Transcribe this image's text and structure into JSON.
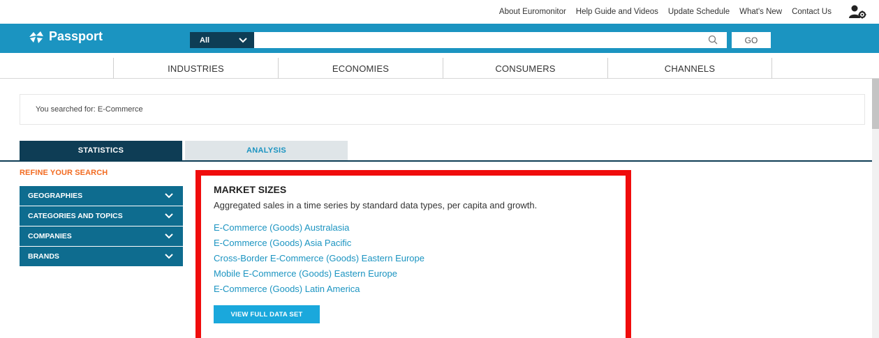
{
  "utility_links": [
    "About Euromonitor",
    "Help Guide and Videos",
    "Update Schedule",
    "What's New",
    "Contact Us"
  ],
  "header": {
    "brand": "Passport",
    "search_scope": "All",
    "search_value": "",
    "go_label": "GO"
  },
  "main_nav": [
    "INDUSTRIES",
    "ECONOMIES",
    "CONSUMERS",
    "CHANNELS"
  ],
  "search_summary": "You searched for: E-Commerce",
  "tabs": {
    "statistics": "STATISTICS",
    "analysis": "ANALYSIS"
  },
  "refine": {
    "title": "REFINE YOUR SEARCH",
    "items": [
      "GEOGRAPHIES",
      "CATEGORIES AND TOPICS",
      "COMPANIES",
      "BRANDS"
    ]
  },
  "market_sizes": {
    "title": "MARKET SIZES",
    "description": "Aggregated sales in a time series by standard data types, per capita and growth.",
    "links": [
      "E-Commerce (Goods) Australasia",
      "E-Commerce (Goods) Asia Pacific",
      "Cross-Border E-Commerce (Goods) Eastern Europe",
      "Mobile E-Commerce (Goods) Eastern Europe",
      "E-Commerce (Goods) Latin America"
    ],
    "button_label": "VIEW FULL DATA SET"
  },
  "colors": {
    "header_blue": "#1b94c1",
    "dark_navy": "#0e3d55",
    "sidebar_teal": "#0e6c8f",
    "accent_orange": "#f26b21",
    "link_blue": "#1b94c1",
    "highlight_red": "#f00c0c",
    "button_blue": "#1aa8dc"
  }
}
